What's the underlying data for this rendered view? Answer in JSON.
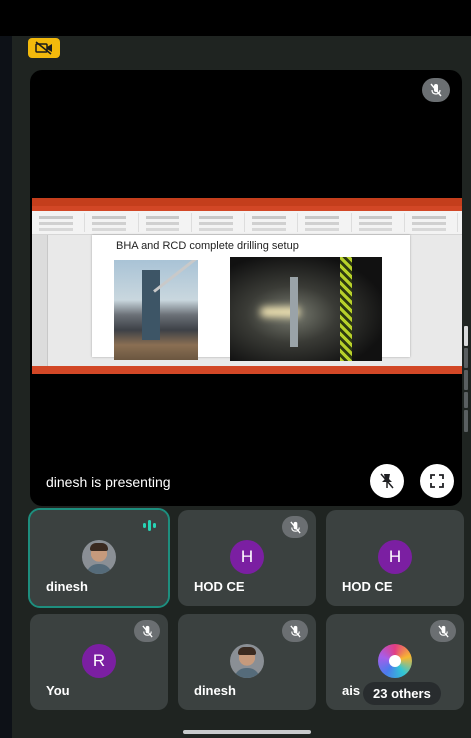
{
  "stage": {
    "presenter_label": "dinesh is presenting"
  },
  "slide": {
    "title": "BHA and RCD complete drilling setup"
  },
  "participants": [
    {
      "name": "dinesh",
      "avatar": "photo",
      "muted": false,
      "speaking": true
    },
    {
      "name": "HOD CE",
      "avatar": "letter",
      "initial": "H",
      "muted": true
    },
    {
      "name": "HOD CE",
      "avatar": "letter",
      "initial": "H",
      "muted": true
    },
    {
      "name": "You",
      "avatar": "letter",
      "initial": "R",
      "muted": true
    },
    {
      "name": "dinesh",
      "avatar": "photo",
      "muted": true
    },
    {
      "name": "ais",
      "avatar": "art",
      "muted": true
    }
  ],
  "others_label": "23 others",
  "colors": {
    "background": "#1f2421",
    "tile": "#3b4140",
    "letter_avatar": "#7b1fa2",
    "active_outline": "#1e8e7e",
    "camera_off_badge": "#f2b90c"
  },
  "icons": [
    "camera-off-icon",
    "mic-off-icon",
    "stop-presenting-icon",
    "fullscreen-icon",
    "speaking-indicator-icon"
  ]
}
